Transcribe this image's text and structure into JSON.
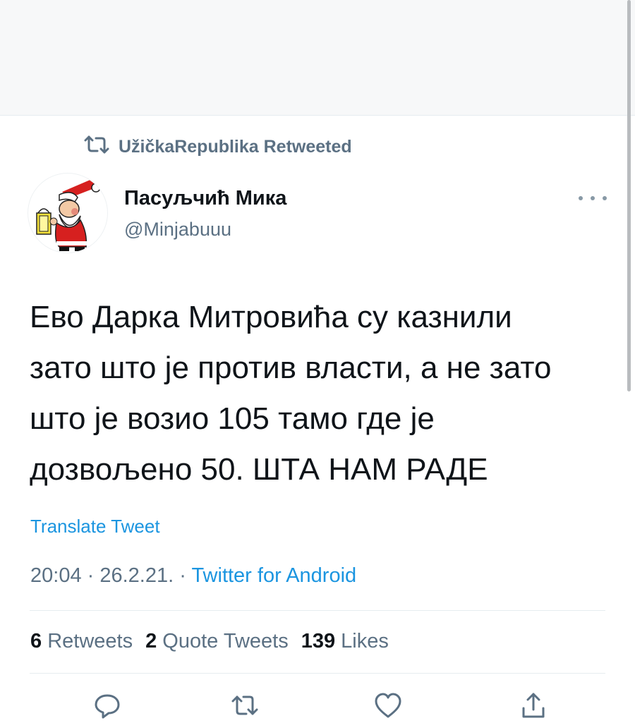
{
  "retweet_context": {
    "text": "UžičkaRepublika Retweeted",
    "icon": "retweet-icon"
  },
  "author": {
    "display_name": "Пасуљчић Мика",
    "handle": "@Minjabuuu",
    "avatar": "santa-avatar"
  },
  "tweet": {
    "text": "Ево Дарка Митровића су казнили\nзато што је против власти, а не зато\nшто је возио 105 тамо где је\nдозвољено 50. ШТА НАМ РАДЕ"
  },
  "translate_label": "Translate Tweet",
  "meta": {
    "time": "20:04",
    "sep1": " · ",
    "date": "26.2.21.",
    "sep2": " · ",
    "source": "Twitter for Android"
  },
  "stats": {
    "retweets_count": "6",
    "retweets_label": "Retweets",
    "quotes_count": "2",
    "quotes_label": "Quote Tweets",
    "likes_count": "139",
    "likes_label": "Likes"
  },
  "actions": [
    "reply-icon",
    "retweet-icon",
    "like-icon",
    "share-icon"
  ],
  "colors": {
    "link": "#1b95e0",
    "secondary": "#5b7083",
    "text": "#0f1419"
  }
}
